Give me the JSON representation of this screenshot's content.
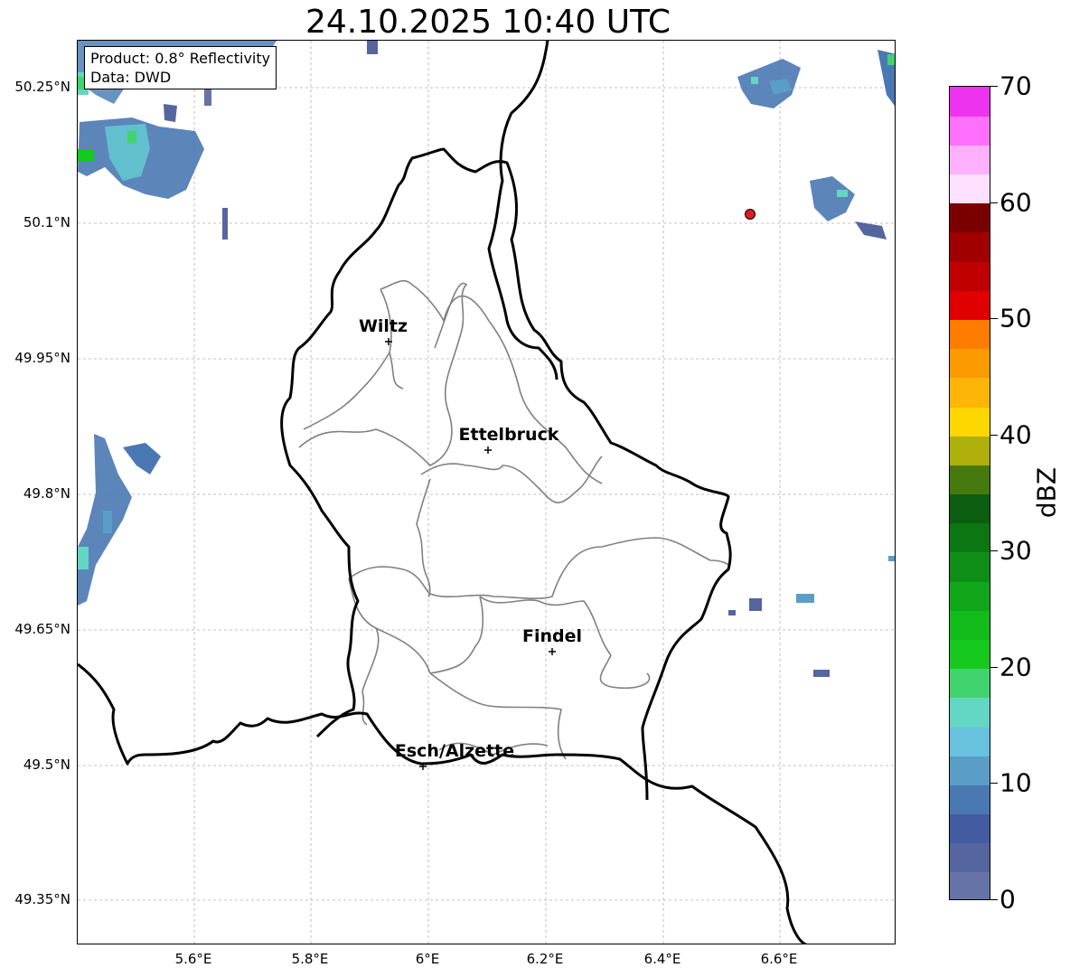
{
  "title": "24.10.2025 10:40 UTC",
  "infobox": {
    "product": "Product: 0.8° Reflectivity",
    "data": "Data: DWD"
  },
  "map": {
    "lat_labels": [
      "50.25°N",
      "50.1°N",
      "49.95°N",
      "49.8°N",
      "49.65°N",
      "49.5°N",
      "49.35°N"
    ],
    "lon_labels": [
      "5.6°E",
      "5.8°E",
      "6°E",
      "6.2°E",
      "6.4°E",
      "6.6°E"
    ],
    "cities": [
      "Wiltz",
      "Ettelbruck",
      "Findel",
      "Esch/Alzette"
    ],
    "colors": {
      "border": "#000000",
      "cantons": "#808080",
      "grid": "#b0b0b0",
      "radar_marker": "#e31a1c"
    }
  },
  "colorbar": {
    "label": "dBZ",
    "tick_labels": [
      "0",
      "10",
      "20",
      "30",
      "40",
      "50",
      "60",
      "70"
    ],
    "colors": [
      "#6673a6",
      "#5465a0",
      "#435ca1",
      "#4a78b3",
      "#5a9ec8",
      "#68c1dd",
      "#63d6c4",
      "#41d46e",
      "#15c91e",
      "#12bc1a",
      "#10a71b",
      "#0f8e17",
      "#0c7613",
      "#0b5e10",
      "#467a0e",
      "#afb00c",
      "#fed700",
      "#fdb508",
      "#fc9a02",
      "#fe7c00",
      "#e00000",
      "#c00000",
      "#a00000",
      "#7a0000",
      "#ffe0ff",
      "#ffb0ff",
      "#ff70ff",
      "#ee33ee"
    ]
  }
}
